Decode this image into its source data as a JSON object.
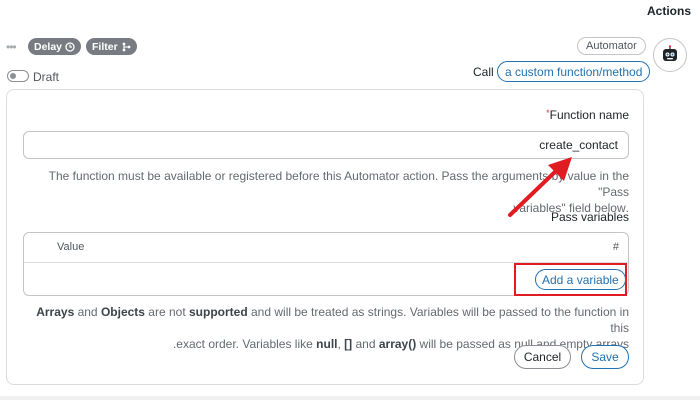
{
  "header": {
    "title": "Actions"
  },
  "toolbar": {
    "more_label": "•••",
    "delay_label": "Delay",
    "filter_label": "Filter",
    "automator_badge": "Automator"
  },
  "draft": {
    "label": "Draft",
    "enabled": false
  },
  "call": {
    "label": "Call",
    "selector": "a custom function/method"
  },
  "form": {
    "function_name_label": "Function name",
    "required_mark": "*",
    "function_name_value": "create_contact",
    "function_help_1": "The function must be available or registered before this Automator action. Pass the arguments by value in the \"Pass",
    "function_help_2": ".variables\" field below",
    "pass_variables_label": "Pass variables",
    "table_headers": {
      "value": "Value",
      "index": "#"
    },
    "add_variable_button": "Add a variable",
    "arrays_note": {
      "w1": "Arrays",
      "w2": " and ",
      "w3": "Objects",
      "w4": " are not ",
      "w5": "supported",
      "w6": " and will be treated as strings. Variables will be passed to the function in this",
      "line2_a": ".exact order. Variables like ",
      "null": "null",
      "sep1": ", ",
      "brackets": "[]",
      "sep2": " and ",
      "array_fn": "array()",
      "line2_b": " will be passed as null and empty arrays"
    },
    "cancel_button": "Cancel",
    "save_button": "Save"
  },
  "colors": {
    "accent": "#2271b1",
    "highlight": "#e11b22",
    "pill_bg": "#787c82"
  },
  "icons": [
    "clock-icon",
    "filter-branch-icon",
    "robot-avatar-icon",
    "annotation-arrow-icon"
  ]
}
